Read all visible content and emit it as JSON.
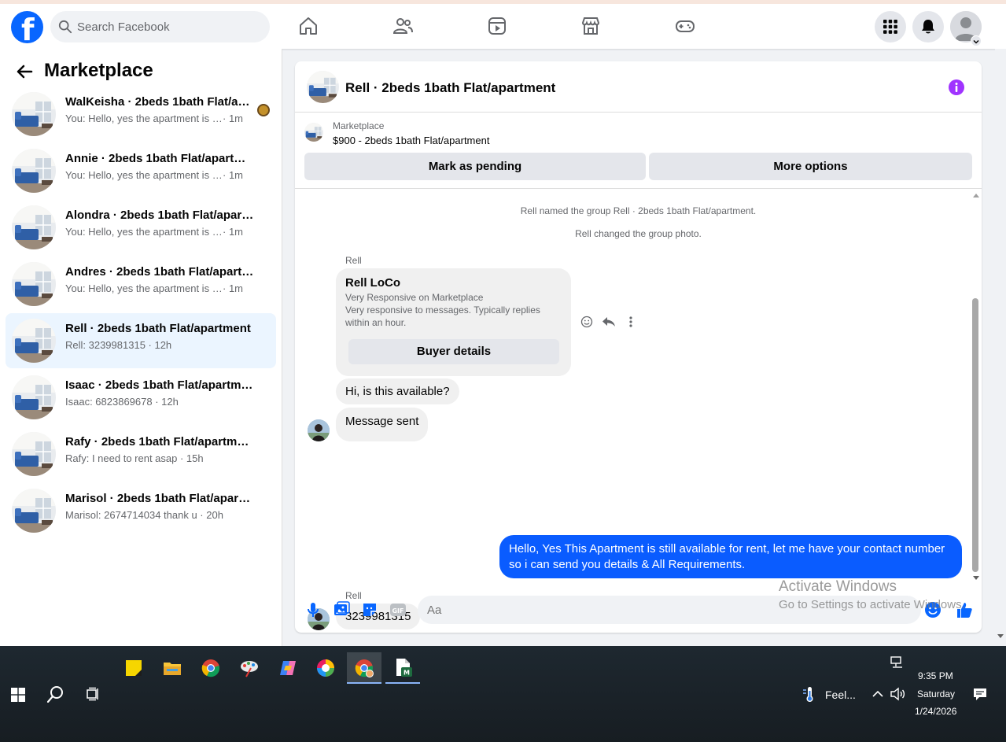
{
  "topbar": {
    "search_placeholder": "Search Facebook",
    "logo_letter": "f",
    "nav": [
      "home-icon",
      "friends-icon",
      "video-icon",
      "marketplace-icon",
      "gaming-icon"
    ],
    "right": [
      "menu-grid-icon",
      "notifications-bell-icon",
      "account-avatar"
    ]
  },
  "sidebar": {
    "title": "Marketplace",
    "conversations": [
      {
        "title": "WalKeisha · 2beds 1bath Flat/ap...",
        "preview": "You: Hello, yes the apartment is sti...",
        "time": "· 1m",
        "read_avatar": true
      },
      {
        "title": "Annie · 2beds 1bath Flat/apartment",
        "preview": "You: Hello, yes the apartment is still a...",
        "time": "· 1m"
      },
      {
        "title": "Alondra · 2beds 1bath Flat/apartm...",
        "preview": "You: Hello, yes the apartment is still a...",
        "time": "· 1m"
      },
      {
        "title": "Andres · 2beds 1bath Flat/apartment",
        "preview": "You: Hello, yes the apartment is still a...",
        "time": "· 1m"
      },
      {
        "title": "Rell · 2beds 1bath Flat/apartment",
        "preview": "Rell: 3239981315",
        "time": " · 12h",
        "active": true
      },
      {
        "title": "Isaac · 2beds 1bath Flat/apartment",
        "preview": "Isaac: 6823869678",
        "time": " · 12h"
      },
      {
        "title": "Rafy · 2beds 1bath Flat/apartment",
        "preview": "Rafy: I need to rent asap",
        "time": " · 15h"
      },
      {
        "title": "Marisol · 2beds 1bath Flat/apartm...",
        "preview": "Marisol: 2674714034 thank u",
        "time": " · 20h"
      }
    ]
  },
  "chat": {
    "title": "Rell · 2beds 1bath Flat/apartment",
    "listing_source": "Marketplace",
    "listing_desc": "$900 - 2beds 1bath Flat/apartment",
    "mark_pending": "Mark as pending",
    "more_options": "More options",
    "system": [
      "Rell named the group Rell · 2beds 1bath Flat/apartment.",
      "Rell changed the group photo."
    ],
    "sender_name": "Rell",
    "profile_card": {
      "name": "Rell LoCo",
      "line1": "Very Responsive on Marketplace",
      "line2": "Very responsive to messages. Typically replies",
      "line3": "within an hour.",
      "button": "Buyer details"
    },
    "msg_in_1": "Hi, is this available?",
    "msg_in_2": "Message sent",
    "msg_out_line1": "Hello, Yes This Apartment is still available for rent, let me have your contact number",
    "msg_out_line2": "so i can send you details & All Requirements.",
    "msg_in_3": "3239981315",
    "composer_placeholder": "Aa"
  },
  "watermark": {
    "line1": "Activate Windows",
    "line2": "Go to Settings to activate Windows."
  },
  "taskbar": {
    "weather": "Feel...",
    "time": "9:35 PM",
    "day": "Saturday",
    "date": "1/24/2026"
  },
  "colors": {
    "facebook_blue": "#0866ff",
    "outgoing_bubble": "#0a5cff",
    "info_purple": "#a033ff",
    "active_row": "#ebf5ff"
  }
}
